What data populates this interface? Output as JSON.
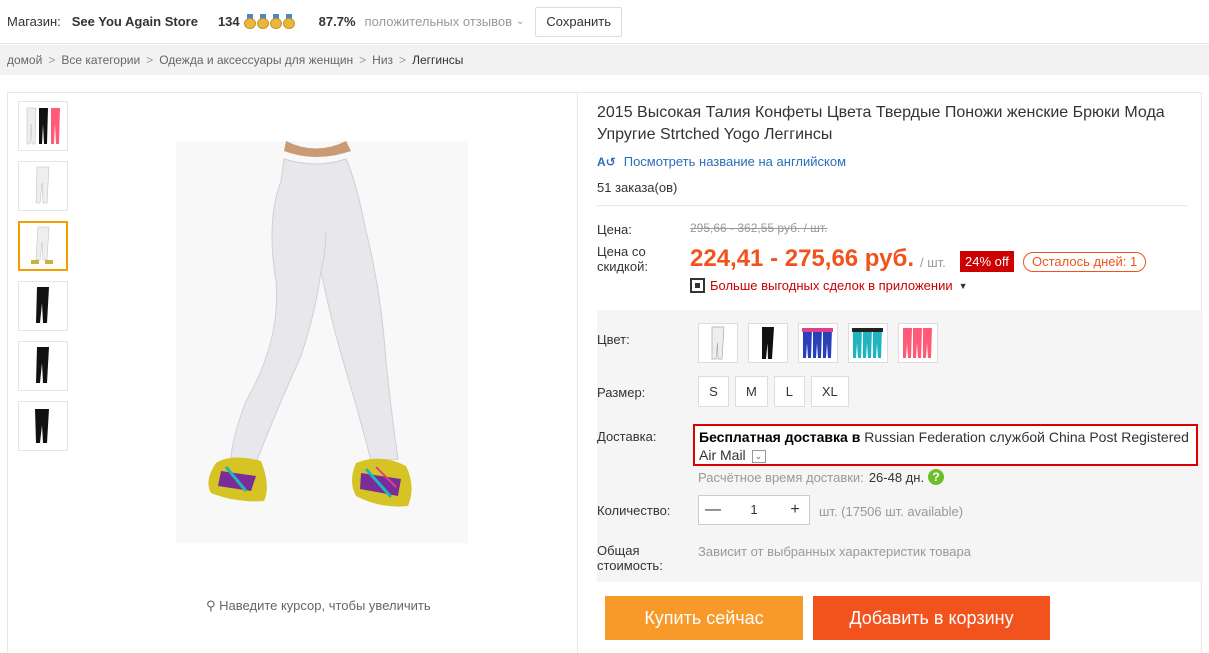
{
  "store": {
    "label": "Магазин:",
    "name": "See You Again Store",
    "score": "134",
    "positive_pct": "87.7%",
    "positive_label": "положительных отзывов",
    "save_label": "Сохранить"
  },
  "breadcrumb": {
    "items": [
      "домой",
      "Все категории",
      "Одежда и аксессуары для женщин",
      "Низ"
    ],
    "current": "Леггинсы",
    "separator": ">"
  },
  "gallery": {
    "zoom_hint": "Наведите курсор, чтобы увеличить"
  },
  "product": {
    "title": "2015 Высокая Талия Конфеты Цвета Твердые Поножи женские Брюки Мода Упругие Strtched Yogo Леггинсы",
    "translate_link": "Посмотреть название на английском",
    "orders": "51 заказа(ов)",
    "price_label": "Цена:",
    "old_price": "295,66 - 362,55 руб. / шт.",
    "discount_label": "Цена со скидкой:",
    "new_price": "224,41 - 275,66 руб.",
    "unit": "/ шт.",
    "off_badge": "24% off",
    "days_left": "Осталось дней: 1",
    "app_deals": "Больше выгодных сделок в приложении",
    "color_label": "Цвет:",
    "size_label": "Размер:",
    "sizes": [
      "S",
      "M",
      "L",
      "XL"
    ],
    "shipping_label": "Доставка:",
    "shipping_bold": "Бесплатная доставка в",
    "shipping_rest": " Russian Federation службой China Post Registered Air Mail",
    "eta_label": "Расчётное время доставки:",
    "eta_days": "26-48 дн.",
    "qty_label": "Количество:",
    "qty_value": "1",
    "qty_info": "шт. (17506 шт. available)",
    "total_label": "Общая стоимость:",
    "total_info": "Зависит от выбранных характеристик товара",
    "buy_now": "Купить сейчас",
    "add_to_cart": "Добавить в корзину"
  },
  "colors": {
    "accent": "#f2521c",
    "buy": "#f79a29",
    "link": "#2a6ebb",
    "swatches": [
      "#ffffff",
      "#111111",
      "#2a3fb8",
      "#1fb5c0",
      "#ff5a78"
    ]
  }
}
